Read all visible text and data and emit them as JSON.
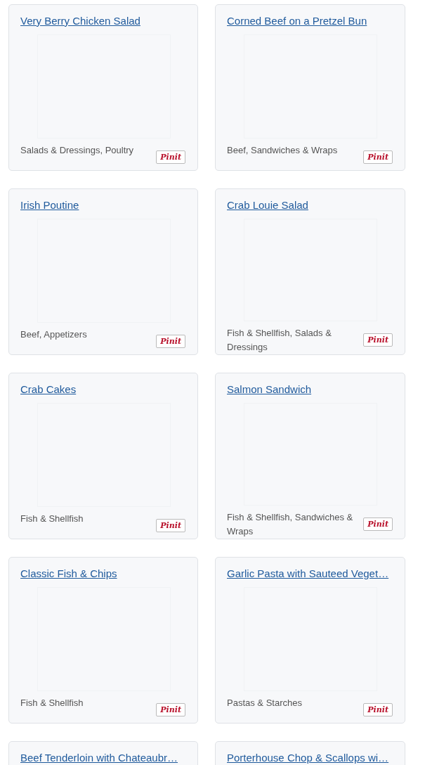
{
  "recipes": [
    {
      "title": "Very Berry Chicken Salad",
      "categories": "Salads & Dressings, Poultry",
      "pin_label": "Pinit"
    },
    {
      "title": "Corned Beef on a Pretzel Bun",
      "categories": "Beef, Sandwiches & Wraps",
      "pin_label": "Pinit"
    },
    {
      "title": "Irish Poutine",
      "categories": "Beef, Appetizers",
      "pin_label": "Pinit"
    },
    {
      "title": "Crab Louie Salad",
      "categories": "Fish & Shellfish, Salads & Dressings",
      "pin_label": "Pinit"
    },
    {
      "title": "Crab Cakes",
      "categories": "Fish & Shellfish",
      "pin_label": "Pinit"
    },
    {
      "title": "Salmon Sandwich",
      "categories": "Fish & Shellfish, Sandwiches & Wraps",
      "pin_label": "Pinit"
    },
    {
      "title": "Classic Fish & Chips",
      "categories": "Fish & Shellfish",
      "pin_label": "Pinit"
    },
    {
      "title": "Garlic Pasta with Sauteed Veget…",
      "categories": "Pastas & Starches",
      "pin_label": "Pinit"
    },
    {
      "title": "Beef Tenderloin with Chateaubr…"
    },
    {
      "title": "Porterhouse Chop & Scallops wi…"
    }
  ]
}
